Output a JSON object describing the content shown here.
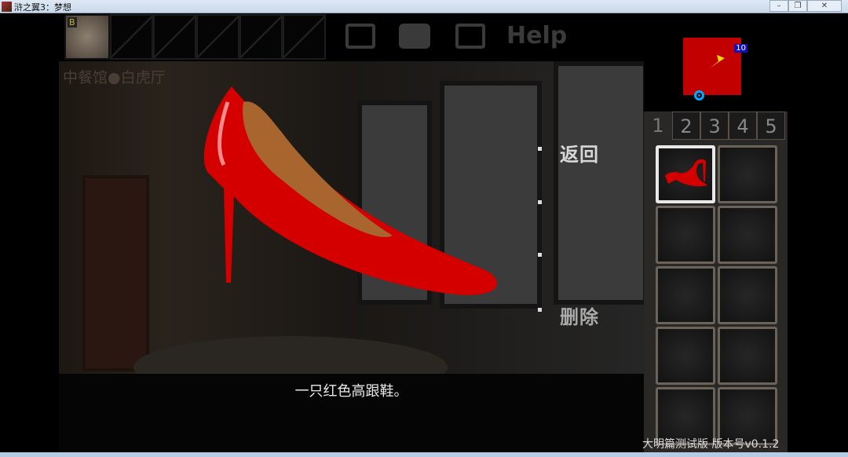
{
  "window": {
    "title": "浒之翼3：梦想",
    "minimize": "–",
    "maximize": "❐",
    "close": "✕"
  },
  "hud": {
    "level_badge": "B",
    "help": "Help"
  },
  "location": "中餐馆●白虎厅",
  "menu": {
    "back": "返回",
    "delete": "删除"
  },
  "caption": "一只红色高跟鞋。",
  "minimap": {
    "badge": "10"
  },
  "inventory": {
    "tabs": [
      "1",
      "2",
      "3",
      "4",
      "5"
    ],
    "active_tab": "1",
    "items": [
      "red high heel"
    ]
  },
  "version": "大明篇测试版  版本号v0.1.2",
  "colors": {
    "shoe": "#d40000",
    "minimap": "#c20000"
  }
}
